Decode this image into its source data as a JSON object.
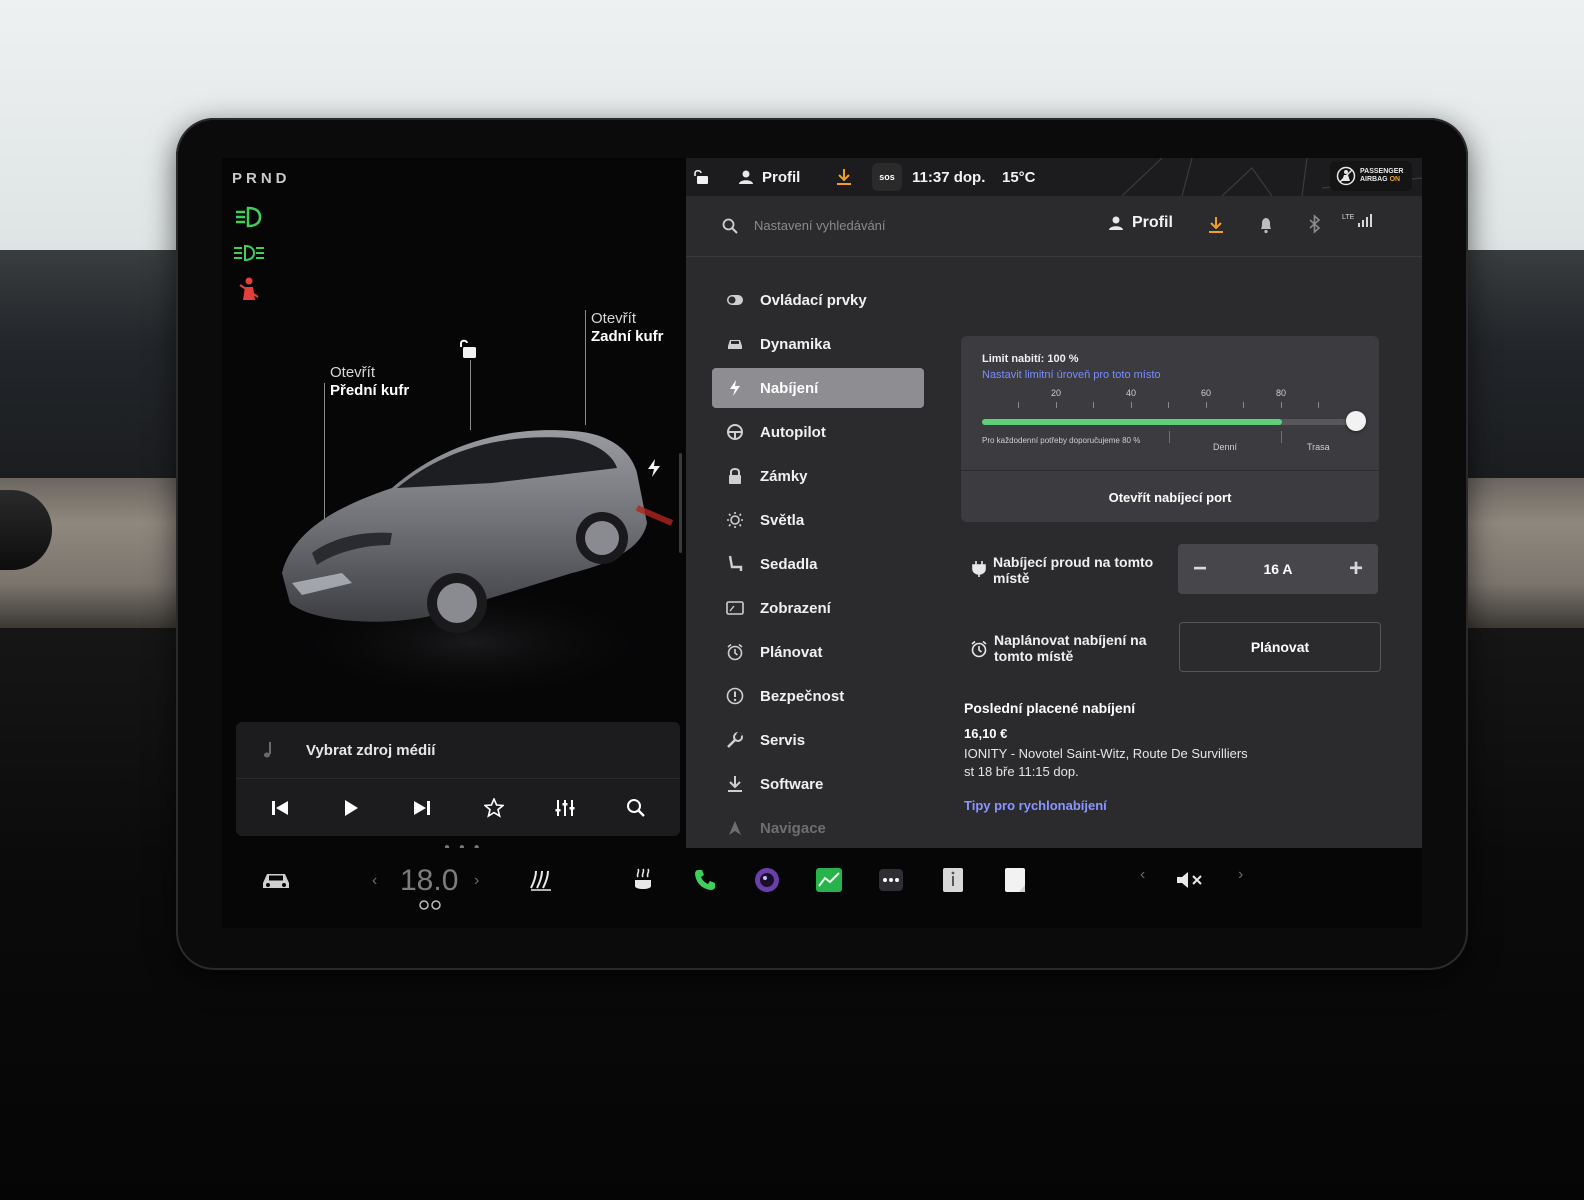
{
  "left_panel": {
    "gear": "PRND",
    "frunk": {
      "line1": "Otevřít",
      "line2": "Přední kufr"
    },
    "trunk": {
      "line1": "Otevřít",
      "line2": "Zadní kufr"
    },
    "media": {
      "source_label": "Vybrat zdroj médií"
    }
  },
  "status_bar": {
    "profile": "Profil",
    "sos": "sos",
    "time": "11:37 dop.",
    "temperature": "15°C",
    "airbag": {
      "line1": "PASSENGER",
      "line2a": "AIRBAG",
      "line2b": "ON"
    }
  },
  "search": {
    "placeholder": "Nastavení vyhledávání",
    "profile": "Profil",
    "signal": "LTE"
  },
  "menu": {
    "items": [
      {
        "label": "Ovládací prvky"
      },
      {
        "label": "Dynamika"
      },
      {
        "label": "Nabíjení"
      },
      {
        "label": "Autopilot"
      },
      {
        "label": "Zámky"
      },
      {
        "label": "Světla"
      },
      {
        "label": "Sedadla"
      },
      {
        "label": "Zobrazení"
      },
      {
        "label": "Plánovat"
      },
      {
        "label": "Bezpečnost"
      },
      {
        "label": "Servis"
      },
      {
        "label": "Software"
      },
      {
        "label": "Navigace"
      }
    ],
    "active_index": 2
  },
  "charging": {
    "limit_label": "Limit nabití: 100 %",
    "limit_value": 100,
    "set_location_link": "Nastavit limitní úroveň pro toto místo",
    "scale": [
      "20",
      "40",
      "60",
      "80"
    ],
    "recommendation": "Pro každodenní potřeby doporučujeme 80 %",
    "zone_daily": "Denní",
    "zone_trip": "Trasa",
    "open_port": "Otevřít nabíjecí port",
    "current_label": "Nabíjecí proud na tomto místě",
    "current_value": "16 A",
    "schedule_label": "Naplánovat nabíjení na tomto místě",
    "schedule_button": "Plánovat",
    "last_paid_title": "Poslední placené nabíjení",
    "last_paid_price": "16,10 €",
    "last_paid_location": "IONITY - Novotel Saint-Witz, Route De Survilliers",
    "last_paid_date": "st 18 bře 11:15 dop.",
    "tips_link": "Tipy pro rychlonabíjení"
  },
  "dock": {
    "temperature": "18.0"
  },
  "colors": {
    "accent_green": "#5fd07a",
    "link_blue": "#7a8cff",
    "warning_red": "#e2403a",
    "download_orange": "#f0a020"
  }
}
